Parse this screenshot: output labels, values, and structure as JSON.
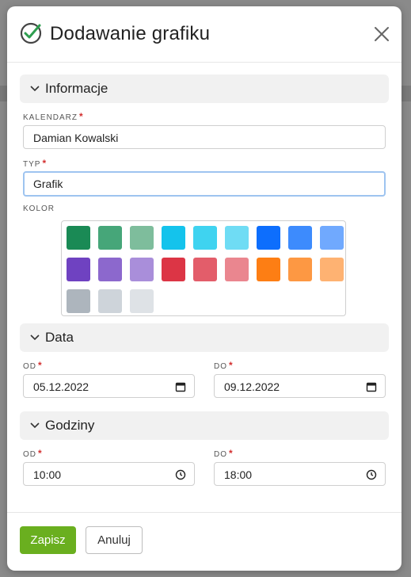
{
  "dialog": {
    "title": "Dodawanie grafiku",
    "close_icon": "close-icon",
    "title_icon": "check-circle-icon",
    "accent_color": "#2e9e4f"
  },
  "sections": {
    "info": "Informacje",
    "date": "Data",
    "hours": "Godziny"
  },
  "fields": {
    "calendar": {
      "label": "KALENDARZ",
      "value": "Damian Kowalski"
    },
    "type": {
      "label": "TYP",
      "value": "Grafik"
    },
    "color": {
      "label": "KOLOR",
      "selected": "#1ec8ef"
    },
    "date_from": {
      "label": "OD",
      "value": "05.12.2022"
    },
    "date_to": {
      "label": "DO",
      "value": "09.12.2022"
    },
    "time_from": {
      "label": "OD",
      "value": "10:00"
    },
    "time_to": {
      "label": "DO",
      "value": "18:00"
    }
  },
  "palette": [
    "#1a8a55",
    "#46a679",
    "#7ebd9c",
    "#14c3ec",
    "#3fd3f0",
    "#6fdcf4",
    "#0d6efd",
    "#3d8bfd",
    "#70a9fe",
    "#6f42c1",
    "#8c68cd",
    "#a98eda",
    "#dc3545",
    "#e35d6a",
    "#ea868f",
    "#fd7e14",
    "#fd9843",
    "#feb272",
    "#adb5bd",
    "#ced4da",
    "#dee2e6"
  ],
  "required_mark": "*",
  "footer": {
    "save": "Zapisz",
    "cancel": "Anuluj"
  }
}
